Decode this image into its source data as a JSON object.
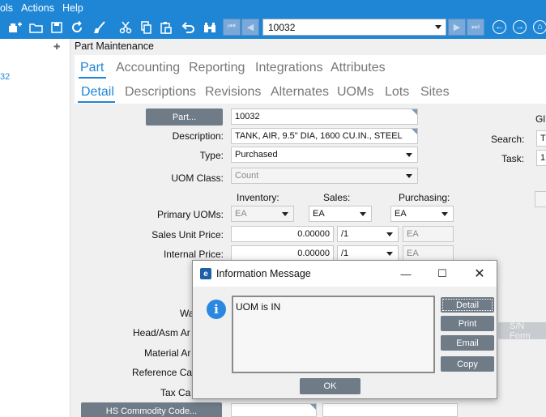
{
  "menu": [
    "ols",
    "Actions",
    "Help"
  ],
  "toolbar": {
    "record_value": "10032",
    "nav_first": "⏮",
    "nav_prev": "◀",
    "nav_next": "▶",
    "nav_last": "⏭"
  },
  "sidebar": {
    "partial_value": "32"
  },
  "panel": {
    "title": "Part Maintenance"
  },
  "tabs_primary": [
    "Part",
    "Accounting",
    "Reporting",
    "Integrations",
    "Attributes"
  ],
  "tabs_secondary": [
    "Detail",
    "Descriptions",
    "Revisions",
    "Alternates",
    "UOMs",
    "Lots",
    "Sites"
  ],
  "form": {
    "part_button": "Part...",
    "part_value": "10032",
    "description_label": "Description:",
    "description_value": "TANK, AIR, 9.5\" DIA, 1600 CU.IN., STEEL",
    "type_label": "Type:",
    "type_value": "Purchased",
    "uom_class_label": "UOM Class:",
    "uom_class_value": "Count",
    "inventory_label": "Inventory:",
    "sales_label": "Sales:",
    "purchasing_label": "Purchasing:",
    "primary_uoms_label": "Primary UOMs:",
    "uom_inventory": "EA",
    "uom_sales": "EA",
    "uom_purchasing": "EA",
    "sales_unit_price_label": "Sales Unit Price:",
    "sales_unit_price": "0.00000",
    "sales_per": "/1",
    "sales_uom": "EA",
    "internal_price_label": "Internal Price:",
    "internal_price": "0.00000",
    "internal_per": "/1",
    "internal_uom": "EA",
    "wa_label": "Wa",
    "head_asm_label": "Head/Asm Ar",
    "material_label": "Material Ar",
    "reference_label": "Reference Ca",
    "tax_label": "Tax Ca",
    "hs_button": "HS Commodity Code...",
    "right_label_top": "Gl",
    "search_label": "Search:",
    "search_value": "T",
    "task_label": "Task:",
    "task_value": "1",
    "sn_format": "S/N Form"
  },
  "dialog": {
    "title": "Information Message",
    "message": "UOM is IN",
    "buttons": [
      "Detail",
      "Print",
      "Email",
      "Copy"
    ],
    "ok": "OK"
  }
}
